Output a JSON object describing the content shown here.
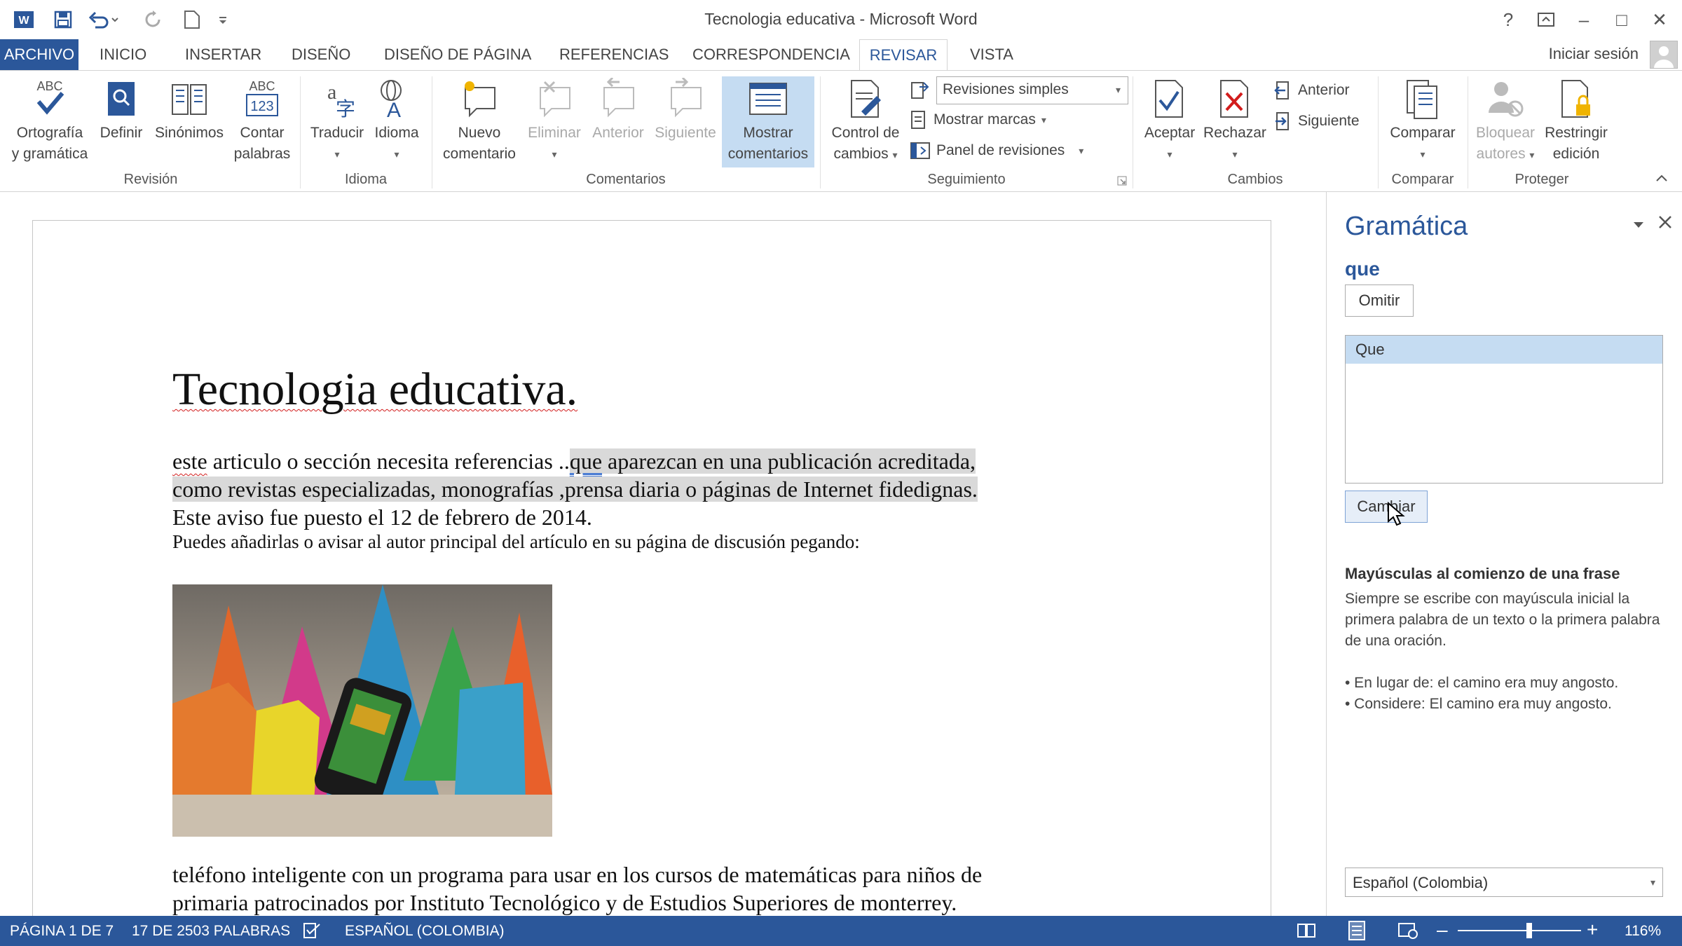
{
  "window": {
    "title": "Tecnologia educativa - Microsoft Word",
    "help_glyph": "?",
    "minimize_glyph": "–",
    "maximize_glyph": "□",
    "close_glyph": "✕"
  },
  "tabs": [
    {
      "label": "ARCHIVO"
    },
    {
      "label": "INICIO"
    },
    {
      "label": "INSERTAR"
    },
    {
      "label": "DISEÑO"
    },
    {
      "label": "DISEÑO DE PÁGINA"
    },
    {
      "label": "REFERENCIAS"
    },
    {
      "label": "CORRESPONDENCIA"
    },
    {
      "label": "REVISAR"
    },
    {
      "label": "VISTA"
    }
  ],
  "signin": "Iniciar sesión",
  "ribbon": {
    "revision": {
      "ortografia_l1": "Ortografía",
      "ortografia_l2": "y gramática",
      "definir": "Definir",
      "sinonimos": "Sinónimos",
      "contar_l1": "Contar",
      "contar_l2": "palabras",
      "abc_text": "ABC",
      "num_text": "123",
      "group": "Revisión"
    },
    "idioma": {
      "traducir": "Traducir",
      "idioma": "Idioma",
      "group": "Idioma"
    },
    "comentarios": {
      "nuevo_l1": "Nuevo",
      "nuevo_l2": "comentario",
      "eliminar": "Eliminar",
      "anterior": "Anterior",
      "siguiente": "Siguiente",
      "mostrar_l1": "Mostrar",
      "mostrar_l2": "comentarios",
      "group": "Comentarios"
    },
    "seguimiento": {
      "control_l1": "Control de",
      "control_l2": "cambios",
      "revisiones": "Revisiones simples",
      "mostrar_marcas": "Mostrar marcas",
      "panel": "Panel de revisiones",
      "group": "Seguimiento"
    },
    "cambios": {
      "aceptar": "Aceptar",
      "rechazar": "Rechazar",
      "anterior": "Anterior",
      "siguiente": "Siguiente",
      "group": "Cambios"
    },
    "comparar": {
      "comparar": "Comparar",
      "group": "Comparar"
    },
    "proteger": {
      "bloquear_l1": "Bloquear",
      "bloquear_l2": "autores",
      "restringir_l1": "Restringir",
      "restringir_l2": "edición",
      "group": "Proteger"
    }
  },
  "document": {
    "heading": "Tecnologia educativa.",
    "p1_a": "este",
    "p1_b": " articulo o sección necesita referencias ..",
    "p1_c": "que",
    "p1_d": " aparezcan en una publicación acreditada,",
    "p1_line2": "como revistas especializadas, monografías ,prensa diaria o páginas de Internet fidedignas.",
    "p1_line3": "Este aviso fue puesto el 12 de febrero de 2014.",
    "p2": "Puedes añadirlas o avisar al autor principal del artículo en su página de discusión pegando:",
    "p3_line1": "teléfono inteligente con un programa para usar en los cursos de matemáticas para niños de",
    "p3_line2": "primaria patrocinados por Instituto Tecnológico y de Estudios Superiores de monterrey."
  },
  "pane": {
    "title": "Gramática",
    "word": "que",
    "omitir": "Omitir",
    "suggestions": [
      "Que"
    ],
    "cambiar": "Cambiar",
    "rule_title": "Mayúsculas al comienzo de una frase",
    "rule_desc": "Siempre se escribe con mayúscula inicial la primera palabra de un texto o la primera palabra de una oración.",
    "example1": "• En lugar de: el camino era muy angosto.",
    "example2": "• Considere: El camino era muy angosto.",
    "language": "Español (Colombia)"
  },
  "status": {
    "page": "PÁGINA 1 DE 7",
    "words": "17 DE 2503 PALABRAS",
    "language": "ESPAÑOL (COLOMBIA)",
    "zoom": "116%",
    "zoom_fraction": 0.58
  },
  "colors": {
    "accent": "#2b579a",
    "selection": "#c5dcf2",
    "highlight": "#d9d9d9",
    "spell_red": "#d21c1c"
  }
}
